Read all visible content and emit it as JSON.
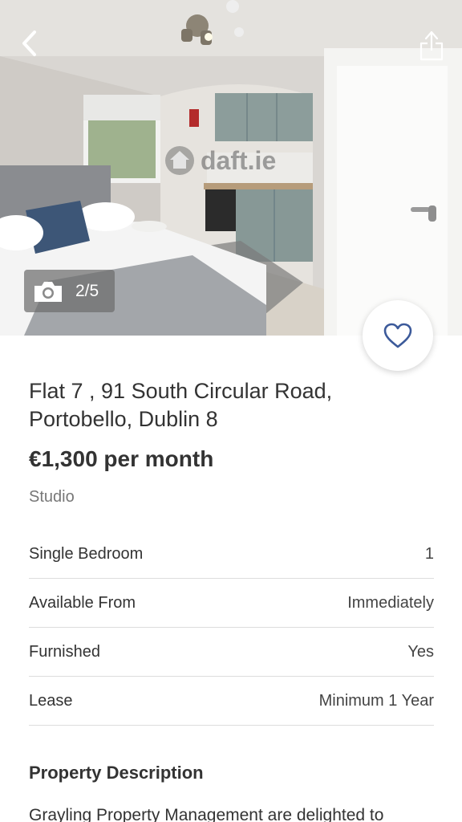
{
  "photo": {
    "watermark_text": "daft.ie",
    "counter": "2/5"
  },
  "listing": {
    "address": "Flat 7 , 91 South Circular Road, Portobello, Dublin 8",
    "price": "€1,300 per month",
    "type": "Studio"
  },
  "facts": [
    {
      "label": "Single Bedroom",
      "value": "1"
    },
    {
      "label": "Available From",
      "value": "Immediately"
    },
    {
      "label": "Furnished",
      "value": "Yes"
    },
    {
      "label": "Lease",
      "value": "Minimum 1 Year"
    }
  ],
  "description": {
    "title": "Property Description",
    "text": "Grayling Property Management are delighted to"
  },
  "icons": {
    "back": "chevron-left-icon",
    "share": "share-icon",
    "camera": "camera-icon",
    "favorite": "heart-outline-icon"
  },
  "colors": {
    "accent": "#3c5a9a",
    "text": "#333333",
    "muted": "#777777"
  }
}
